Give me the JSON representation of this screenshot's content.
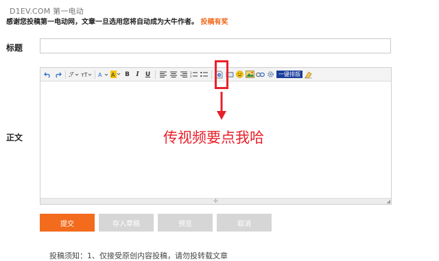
{
  "watermark": "D1EV.COM 第一电动",
  "notice": {
    "text": "感谢您投稿第一电动网，文章一旦选用您将自动成为大牛作者。",
    "link": "投稿有奖"
  },
  "form": {
    "title_label": "标题",
    "title_value": "",
    "body_label": "正文"
  },
  "toolbar": {
    "items": [
      "undo-icon",
      "redo-icon",
      "font-family-icon",
      "font-size-icon",
      "font-color-icon",
      "highlight-color-icon",
      "bold-icon",
      "italic-icon",
      "underline-icon",
      "align-left-icon",
      "align-center-icon",
      "align-right-icon",
      "ordered-list-icon",
      "unordered-list-icon",
      "video-icon",
      "music-icon",
      "emotion-icon",
      "image-icon",
      "link-icon",
      "settings-icon",
      "typeset-icon",
      "clear-icon"
    ],
    "typeset_label": "一键排版"
  },
  "annotation": "传视频要点我哈",
  "buttons": {
    "submit": "提交",
    "draft": "存入草稿",
    "preview": "预览",
    "cancel": "取消"
  },
  "footnote": "投稿须知：1、仅接受原创内容投稿，请勿投转载文章",
  "colors": {
    "accent": "#f36b1d",
    "annotation": "#e8202a",
    "typeset": "#1a3d9b"
  }
}
